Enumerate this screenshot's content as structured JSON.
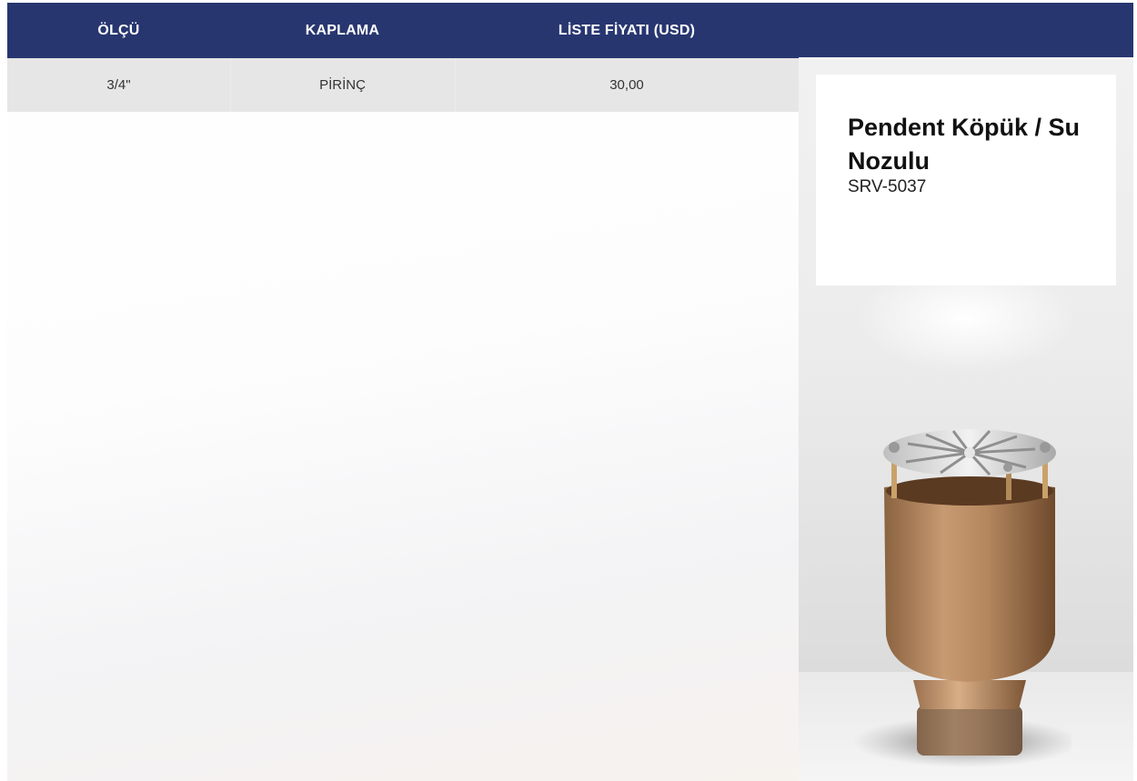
{
  "table": {
    "headers": [
      "ÖLÇÜ",
      "KAPLAMA",
      "LİSTE FİYATI (USD)"
    ],
    "rows": [
      [
        "3/4\"",
        "PİRİNÇ",
        "30,00"
      ]
    ]
  },
  "product": {
    "name": "Pendent Köpük / Su Nozulu",
    "code": "SRV-5037",
    "image_icon": "foam-water-nozzle-image"
  },
  "colors": {
    "header_bg": "#283670",
    "header_text": "#ffffff",
    "row_bg": "#e6e6e6"
  }
}
